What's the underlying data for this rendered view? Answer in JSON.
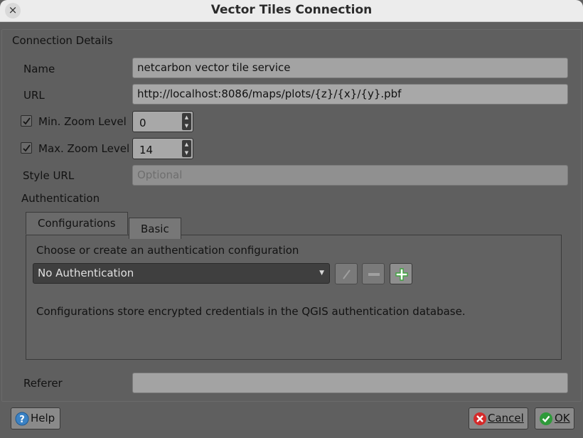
{
  "window": {
    "title": "Vector Tiles Connection",
    "close_icon": "×"
  },
  "connection": {
    "group_title": "Connection Details",
    "name_label": "Name",
    "name_value": "netcarbon vector tile service",
    "url_label": "URL",
    "url_value": "http://localhost:8086/maps/plots/{z}/{x}/{y}.pbf",
    "min_zoom_label": "Min. Zoom Level",
    "min_zoom_value": "0",
    "min_zoom_checked": true,
    "max_zoom_label": "Max. Zoom Level",
    "max_zoom_value": "14",
    "max_zoom_checked": true,
    "style_url_label": "Style URL",
    "style_url_placeholder": "Optional",
    "authentication_label": "Authentication",
    "referer_label": "Referer",
    "referer_value": ""
  },
  "auth": {
    "tabs": [
      {
        "label": "Configurations",
        "active": true
      },
      {
        "label": "Basic",
        "active": false
      }
    ],
    "prompt": "Choose or create an authentication configuration",
    "selected_config": "No Authentication",
    "note": "Configurations store encrypted credentials in the QGIS authentication database."
  },
  "buttons": {
    "help": "Help",
    "cancel": "Cancel",
    "ok": "OK"
  },
  "colors": {
    "help_icon": "#3b82c4",
    "cancel_icon": "#d42a2a",
    "ok_icon": "#2e9a3a",
    "add_icon": "#3fa43f"
  }
}
